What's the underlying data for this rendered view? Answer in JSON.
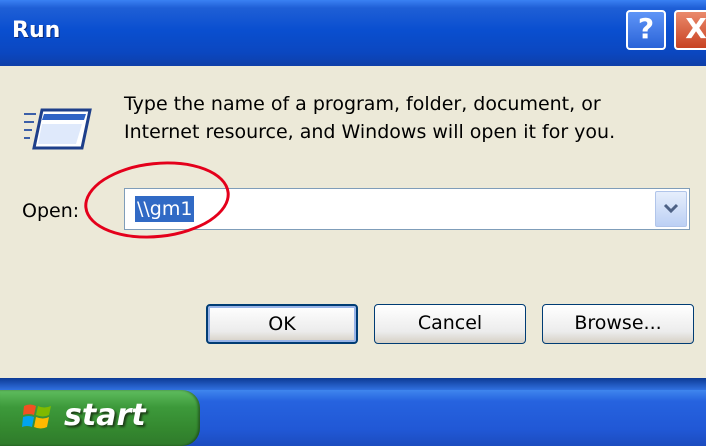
{
  "window": {
    "title": "Run",
    "help_glyph": "?",
    "close_glyph": "X"
  },
  "dialog": {
    "icon": "run-icon",
    "message_line1": "Type the name of a program, folder, document, or",
    "message_line2": "Internet resource, and Windows will open it for you.",
    "open_label": "Open:",
    "open_value": "\\\\gm1",
    "buttons": {
      "ok": "OK",
      "cancel": "Cancel",
      "browse": "Browse..."
    }
  },
  "annotation": {
    "shape": "ellipse",
    "color": "#e4001b"
  },
  "taskbar": {
    "start_label": "start"
  },
  "colors": {
    "titlebar": "#0a4fd0",
    "dialog_bg": "#ece9d8",
    "selection": "#316ac5",
    "start_green": "#3d9a3b",
    "taskbar_blue": "#2158d6"
  }
}
